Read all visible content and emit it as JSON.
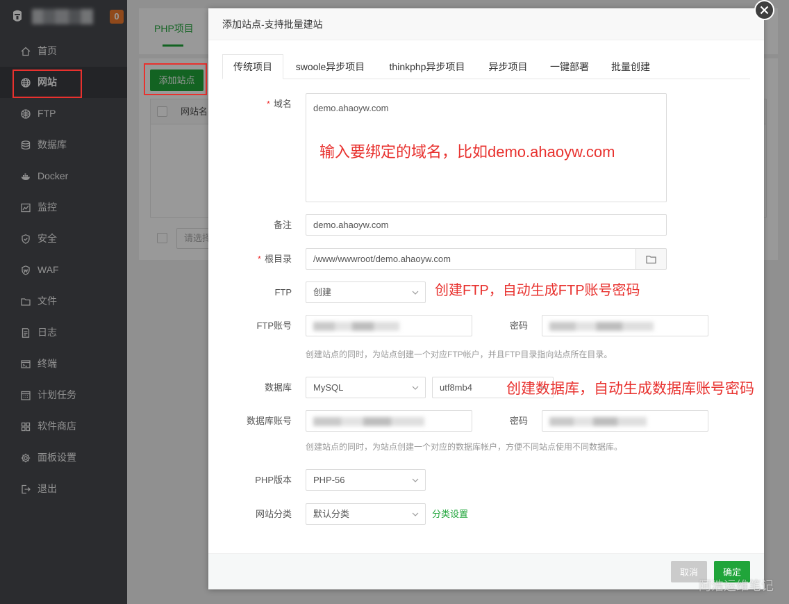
{
  "sidebar": {
    "badge": "0",
    "items": [
      {
        "label": "首页",
        "icon": "home-icon"
      },
      {
        "label": "网站",
        "icon": "globe-icon",
        "active": true
      },
      {
        "label": "FTP",
        "icon": "ftp-icon"
      },
      {
        "label": "数据库",
        "icon": "database-icon"
      },
      {
        "label": "Docker",
        "icon": "docker-icon"
      },
      {
        "label": "监控",
        "icon": "monitor-icon"
      },
      {
        "label": "安全",
        "icon": "shield-icon"
      },
      {
        "label": "WAF",
        "icon": "waf-icon"
      },
      {
        "label": "文件",
        "icon": "folder-icon"
      },
      {
        "label": "日志",
        "icon": "log-icon"
      },
      {
        "label": "终端",
        "icon": "terminal-icon"
      },
      {
        "label": "计划任务",
        "icon": "calendar-icon"
      },
      {
        "label": "软件商店",
        "icon": "grid-icon"
      },
      {
        "label": "面板设置",
        "icon": "gear-icon"
      },
      {
        "label": "退出",
        "icon": "logout-icon"
      }
    ]
  },
  "main": {
    "tab": "PHP项目",
    "add_site_button": "添加站点",
    "table_col_site_name": "网站名",
    "batch_select_placeholder": "请选择"
  },
  "modal": {
    "title": "添加站点-支持批量建站",
    "tabs": [
      {
        "label": "传统项目",
        "active": true
      },
      {
        "label": "swoole异步项目"
      },
      {
        "label": "thinkphp异步项目"
      },
      {
        "label": "异步项目"
      },
      {
        "label": "一键部署"
      },
      {
        "label": "批量创建"
      }
    ],
    "form": {
      "required_mark": "*",
      "domain": {
        "label": "域名",
        "value": "demo.ahaoyw.com"
      },
      "remark": {
        "label": "备注",
        "value": "demo.ahaoyw.com"
      },
      "root_dir": {
        "label": "根目录",
        "value": "/www/wwwroot/demo.ahaoyw.com"
      },
      "ftp": {
        "label": "FTP",
        "value": "创建"
      },
      "ftp_account": {
        "label": "FTP账号",
        "password_label": "密码",
        "help": "创建站点的同时，为站点创建一个对应FTP帐户，并且FTP目录指向站点所在目录。"
      },
      "database": {
        "label": "数据库",
        "type": "MySQL",
        "charset": "utf8mb4"
      },
      "db_account": {
        "label": "数据库账号",
        "password_label": "密码",
        "help": "创建站点的同时，为站点创建一个对应的数据库帐户，方便不同站点使用不同数据库。"
      },
      "php_version": {
        "label": "PHP版本",
        "value": "PHP-56"
      },
      "category": {
        "label": "网站分类",
        "value": "默认分类",
        "settings_link": "分类设置"
      }
    },
    "footer": {
      "cancel": "取消",
      "confirm": "确定"
    }
  },
  "annotations": {
    "domain_hint": "输入要绑定的域名，比如demo.ahaoyw.com",
    "ftp_hint": "创建FTP，自动生成FTP账号密码",
    "db_hint": "创建数据库，自动生成数据库账号密码"
  },
  "watermark": "阿浩运维笔记",
  "colors": {
    "accent": "#20a53a",
    "annotation": "#e8312e",
    "badge": "#f07b2e"
  }
}
